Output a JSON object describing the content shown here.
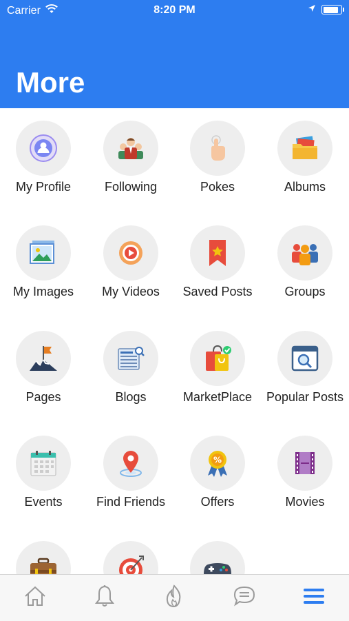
{
  "status": {
    "carrier": "Carrier",
    "time": "8:20 PM",
    "battery_level": 0.9
  },
  "header": {
    "title": "More"
  },
  "colors": {
    "accent": "#2d7df0",
    "tile_bg": "#eeeeee",
    "tab_active": "#2d7df0",
    "tab_inactive": "#9a9a9a"
  },
  "items": [
    {
      "label": "My Profile",
      "icon": "profile-icon"
    },
    {
      "label": "Following",
      "icon": "following-icon"
    },
    {
      "label": "Pokes",
      "icon": "poke-icon"
    },
    {
      "label": "Albums",
      "icon": "folder-icon"
    },
    {
      "label": "My Images",
      "icon": "image-icon"
    },
    {
      "label": "My Videos",
      "icon": "play-icon"
    },
    {
      "label": "Saved Posts",
      "icon": "bookmark-icon"
    },
    {
      "label": "Groups",
      "icon": "groups-icon"
    },
    {
      "label": "Pages",
      "icon": "flag-icon"
    },
    {
      "label": "Blogs",
      "icon": "blog-icon"
    },
    {
      "label": "MarketPlace",
      "icon": "shopping-bag-icon"
    },
    {
      "label": "Popular Posts",
      "icon": "popular-icon"
    },
    {
      "label": "Events",
      "icon": "calendar-icon"
    },
    {
      "label": "Find Friends",
      "icon": "location-pin-icon"
    },
    {
      "label": "Offers",
      "icon": "badge-icon"
    },
    {
      "label": "Movies",
      "icon": "film-icon"
    },
    {
      "label": "",
      "icon": "briefcase-icon"
    },
    {
      "label": "",
      "icon": "target-icon"
    },
    {
      "label": "",
      "icon": "gamepad-icon"
    }
  ],
  "tabs": [
    {
      "name": "home",
      "icon": "home-icon",
      "active": false
    },
    {
      "name": "notifications",
      "icon": "bell-icon",
      "active": false
    },
    {
      "name": "trending",
      "icon": "flame-icon",
      "active": false
    },
    {
      "name": "messages",
      "icon": "chat-icon",
      "active": false
    },
    {
      "name": "more",
      "icon": "menu-icon",
      "active": true
    }
  ]
}
